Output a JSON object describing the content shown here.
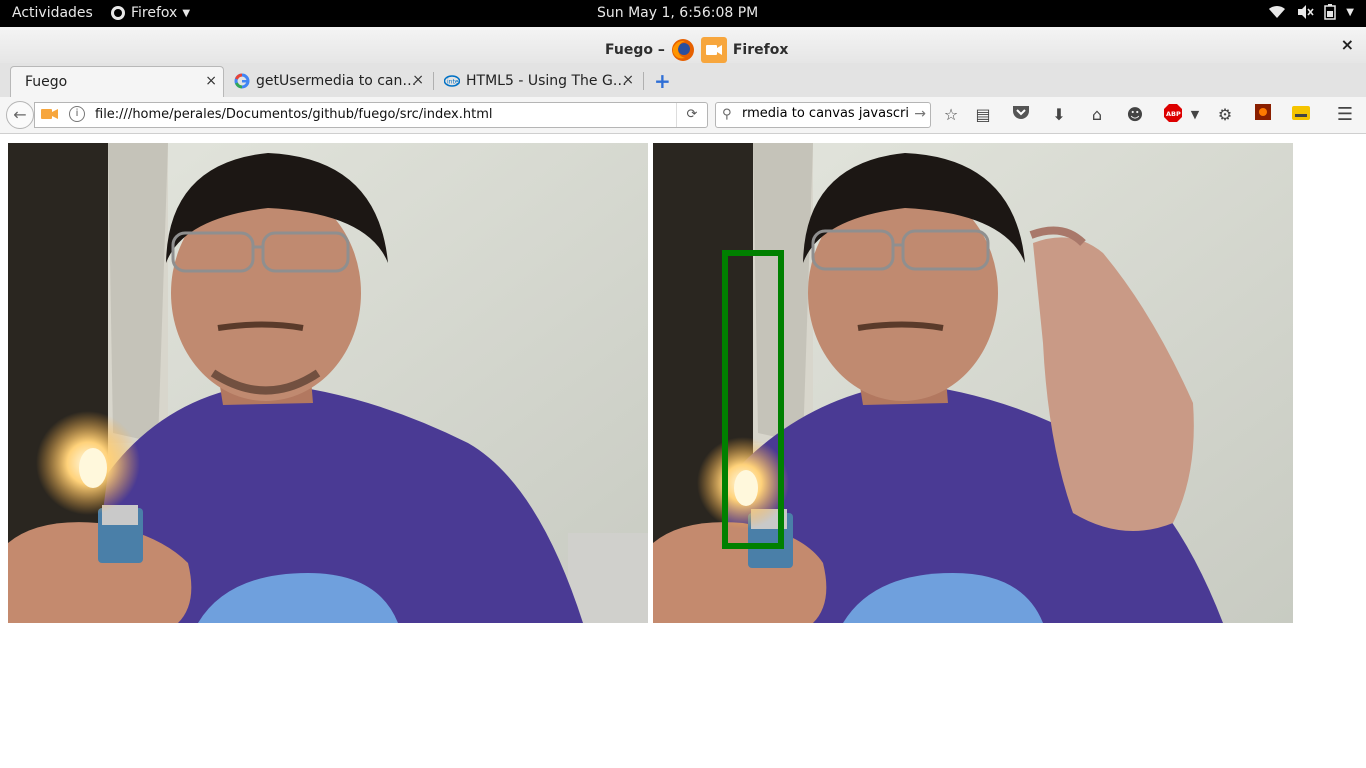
{
  "topbar": {
    "activities": "Actividades",
    "app_menu": "Firefox",
    "clock": "Sun May  1,  6:56:08 PM"
  },
  "window": {
    "title_left": "Fuego –",
    "title_right": "Firefox",
    "close": "×"
  },
  "tabs": [
    {
      "label": "Fuego",
      "active": true
    },
    {
      "label": "getUsermedia to can…",
      "favicon": "google-icon"
    },
    {
      "label": "HTML5 - Using The G…",
      "favicon": "intel-icon"
    }
  ],
  "tab_close": "×",
  "new_tab": "+",
  "navbar": {
    "url": "file:///home/perales/Documentos/github/fuego/src/index.html",
    "search_value": "rmedia to canvas javascript"
  },
  "colors": {
    "detection_box": "#008000",
    "shirt": "#4a3a94",
    "wall": "#d9dcd3"
  },
  "content": {
    "left_view": "webcam-video",
    "right_view": "canvas-with-detection"
  }
}
